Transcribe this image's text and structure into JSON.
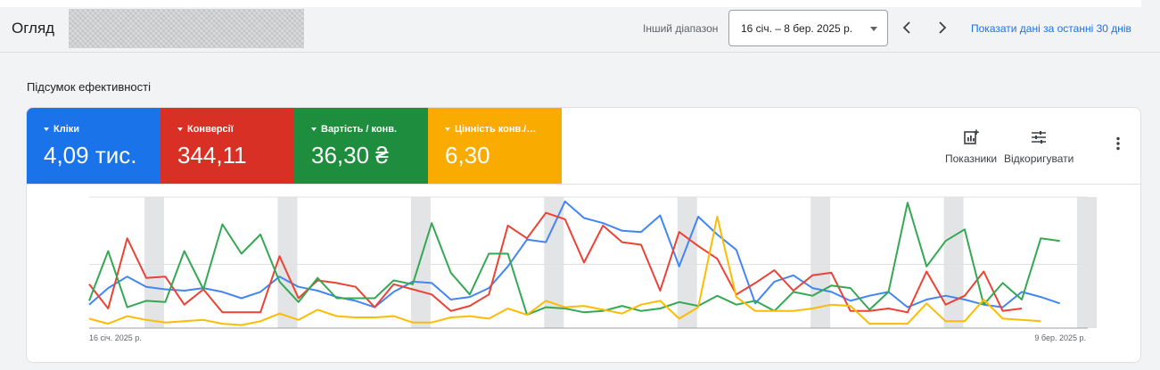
{
  "header": {
    "title": "Огляд",
    "range_label": "Інший діапазон",
    "date_range": "16 січ. – 8 бер. 2025 р.",
    "last_30_link": "Показати дані за останні 30 днів"
  },
  "summary": {
    "title": "Підсумок ефективності",
    "tiles": [
      {
        "label": "Кліки",
        "value": "4,09 тис.",
        "color": "#1a73e8"
      },
      {
        "label": "Конверсії",
        "value": "344,11",
        "color": "#d93025"
      },
      {
        "label": "Вартість / конв.",
        "value": "36,30 ₴",
        "color": "#1e8e3e"
      },
      {
        "label": "Цінність конв./…",
        "value": "6,30",
        "color": "#f9ab00"
      }
    ],
    "tools": {
      "metrics_label": "Показники",
      "adjust_label": "Відкоригувати"
    }
  },
  "chart_data": {
    "type": "line",
    "x_start_label": "16 січ. 2025 р.",
    "x_end_label": "9 бер. 2025 р.",
    "grid": true,
    "weekend_shading": true,
    "series": [
      {
        "color": "#4285f4",
        "values": [
          0.17,
          0.3,
          0.39,
          0.31,
          0.29,
          0.28,
          0.3,
          0.27,
          0.22,
          0.27,
          0.39,
          0.31,
          0.28,
          0.23,
          0.2,
          0.15,
          0.27,
          0.35,
          0.34,
          0.21,
          0.23,
          0.3,
          0.47,
          0.68,
          0.66,
          0.98,
          0.85,
          0.81,
          0.75,
          0.74,
          0.87,
          0.47,
          0.86,
          0.72,
          0.6,
          0.18,
          0.35,
          0.4,
          0.3,
          0.27,
          0.2,
          0.24,
          0.27,
          0.15,
          0.21,
          0.24,
          0.21,
          0.17,
          0.15,
          0.27,
          0.23,
          0.18
        ]
      },
      {
        "color": "#ea4335",
        "values": [
          0.33,
          0.14,
          0.69,
          0.38,
          0.39,
          0.17,
          0.29,
          0.11,
          0.11,
          0.11,
          0.55,
          0.22,
          0.36,
          0.34,
          0.31,
          0.15,
          0.33,
          0.29,
          0.25,
          0.12,
          0.16,
          0.25,
          0.79,
          0.69,
          0.89,
          0.84,
          0.5,
          0.79,
          0.66,
          0.64,
          0.28,
          0.74,
          0.63,
          0.53,
          0.25,
          0.34,
          0.44,
          0.28,
          0.4,
          0.42,
          0.12,
          0.12,
          0.14,
          0.11,
          0.43,
          0.17,
          0.24,
          0.43,
          0.12,
          0.14
        ]
      },
      {
        "color": "#34a853",
        "values": [
          0.2,
          0.59,
          0.15,
          0.2,
          0.19,
          0.59,
          0.29,
          0.8,
          0.57,
          0.72,
          0.35,
          0.19,
          0.38,
          0.22,
          0.22,
          0.22,
          0.36,
          0.33,
          0.81,
          0.42,
          0.25,
          0.57,
          0.57,
          0.09,
          0.15,
          0.14,
          0.11,
          0.12,
          0.16,
          0.12,
          0.14,
          0.19,
          0.16,
          0.24,
          0.17,
          0.2,
          0.12,
          0.27,
          0.24,
          0.32,
          0.3,
          0.13,
          0.27,
          0.97,
          0.47,
          0.67,
          0.76,
          0.17,
          0.34,
          0.21,
          0.69,
          0.67
        ]
      },
      {
        "color": "#fbbc04",
        "values": [
          0.06,
          0.02,
          0.08,
          0.05,
          0.03,
          0.04,
          0.05,
          0.02,
          0.01,
          0.04,
          0.1,
          0.05,
          0.13,
          0.08,
          0.07,
          0.07,
          0.08,
          0.03,
          0.03,
          0.07,
          0.08,
          0.06,
          0.14,
          0.09,
          0.2,
          0.15,
          0.16,
          0.13,
          0.1,
          0.17,
          0.2,
          0.06,
          0.15,
          0.86,
          0.23,
          0.12,
          0.12,
          0.12,
          0.14,
          0.17,
          0.16,
          0.02,
          0.02,
          0.02,
          0.18,
          0.04,
          0.04,
          0.21,
          0.06,
          0.05,
          0.04
        ]
      }
    ]
  }
}
